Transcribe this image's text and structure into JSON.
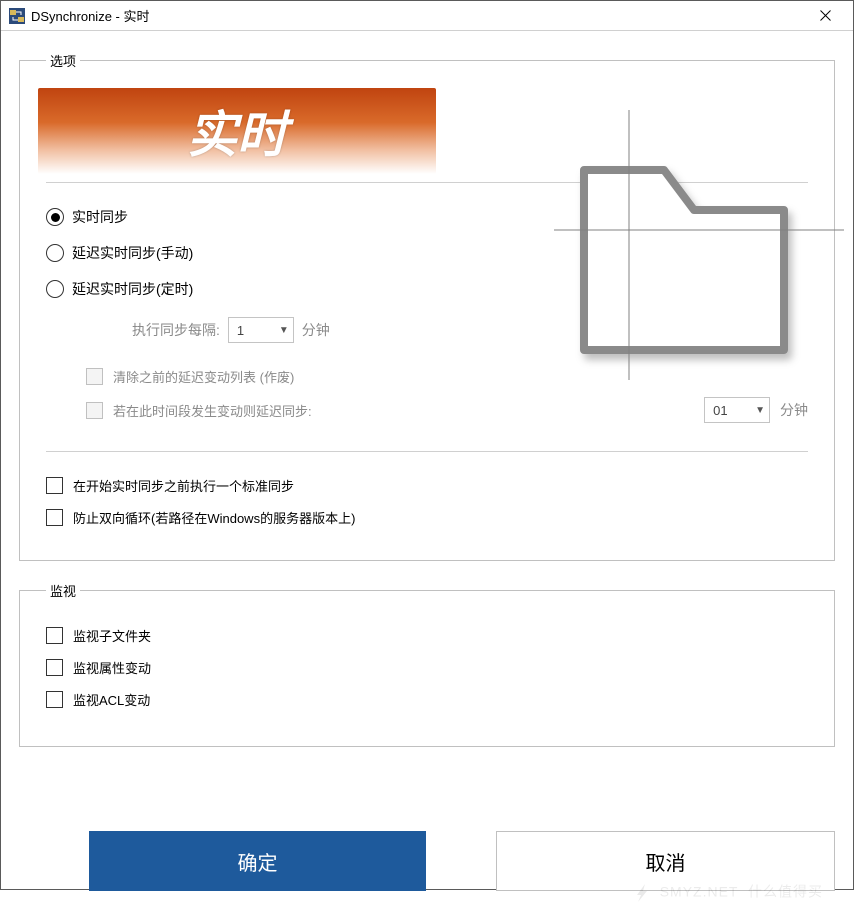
{
  "window": {
    "title": "DSynchronize - 实时"
  },
  "options": {
    "legend": "选项",
    "banner": "实时",
    "radios": [
      {
        "label": "实时同步",
        "selected": true
      },
      {
        "label": "延迟实时同步(手动)",
        "selected": false
      },
      {
        "label": "延迟实时同步(定时)",
        "selected": false
      }
    ],
    "interval": {
      "label": "执行同步每隔:",
      "value": "1",
      "unit": "分钟"
    },
    "delayed": {
      "clear_list": "清除之前的延迟变动列表 (作废)",
      "postpone_if_changes": "若在此时间段发生变动则延迟同步:",
      "postpone_value": "01",
      "postpone_unit": "分钟"
    },
    "bottom": {
      "standard_sync_first": "在开始实时同步之前执行一个标准同步",
      "prevent_loop": "防止双向循环(若路径在Windows的服务器版本上)"
    }
  },
  "monitor": {
    "legend": "监视",
    "items": [
      "监视子文件夹",
      "监视属性变动",
      "监视ACL变动"
    ]
  },
  "buttons": {
    "ok": "确定",
    "cancel": "取消"
  },
  "watermark": "SMYZ.NET"
}
